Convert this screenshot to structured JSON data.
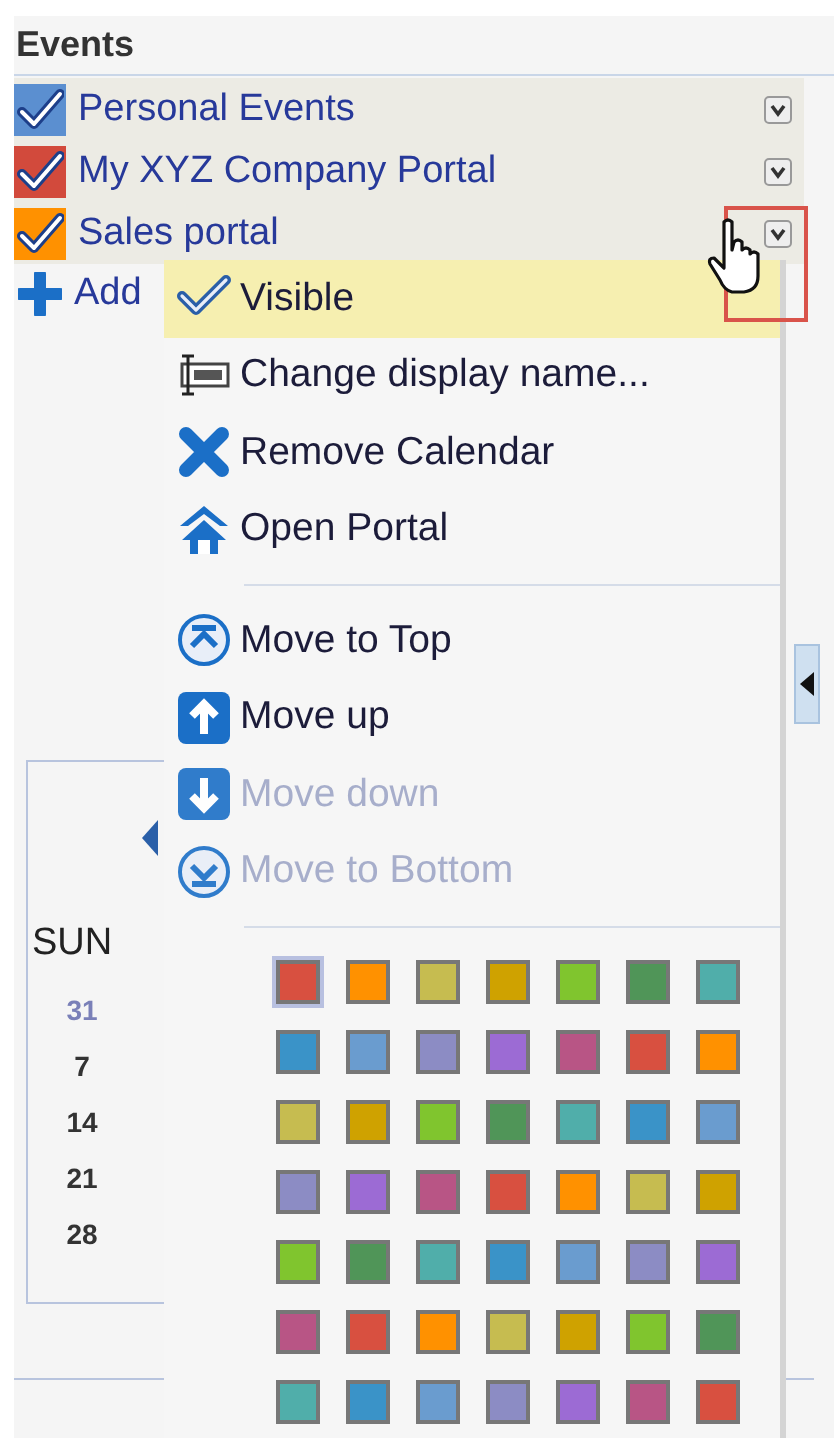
{
  "panel": {
    "title": "Events"
  },
  "calendars": [
    {
      "name": "Personal Events",
      "color": "#5b8fd0",
      "checked": true
    },
    {
      "name": "My XYZ Company Portal",
      "color": "#d24a3c",
      "checked": true
    },
    {
      "name": "Sales portal",
      "color": "#ff9100",
      "checked": true
    }
  ],
  "add_link": {
    "label": "Add"
  },
  "mini_calendar": {
    "weekday": "SUN",
    "days": [
      {
        "label": "31",
        "other_month": true
      },
      {
        "label": "7",
        "other_month": false
      },
      {
        "label": "14",
        "other_month": false
      },
      {
        "label": "21",
        "other_month": false
      },
      {
        "label": "28",
        "other_month": false
      }
    ]
  },
  "context_menu": {
    "groups": [
      [
        {
          "kind": "check",
          "label": "Visible",
          "checked": true,
          "selected": true,
          "disabled": false
        },
        {
          "kind": "rename",
          "label": "Change display name...",
          "selected": false,
          "disabled": false
        },
        {
          "kind": "remove",
          "label": "Remove Calendar",
          "selected": false,
          "disabled": false
        },
        {
          "kind": "portal",
          "label": "Open Portal",
          "selected": false,
          "disabled": false
        }
      ],
      [
        {
          "kind": "top",
          "label": "Move to Top",
          "selected": false,
          "disabled": false
        },
        {
          "kind": "up",
          "label": "Move up",
          "selected": false,
          "disabled": false
        },
        {
          "kind": "down",
          "label": "Move down",
          "selected": false,
          "disabled": true
        },
        {
          "kind": "bottom",
          "label": "Move to Bottom",
          "selected": false,
          "disabled": true
        }
      ]
    ],
    "palette": [
      {
        "color": "#d85040",
        "selected": true
      },
      {
        "color": "#ff9100",
        "selected": false
      },
      {
        "color": "#c6bc50",
        "selected": false
      },
      {
        "color": "#cfa200",
        "selected": false
      },
      {
        "color": "#80c52e",
        "selected": false
      },
      {
        "color": "#509558",
        "selected": false
      },
      {
        "color": "#50aeaa",
        "selected": false
      },
      {
        "color": "#3a93c8",
        "selected": false
      },
      {
        "color": "#6a9ccf",
        "selected": false
      },
      {
        "color": "#8c8cc4",
        "selected": false
      },
      {
        "color": "#9c6bd4",
        "selected": false
      },
      {
        "color": "#b85585",
        "selected": false
      },
      {
        "color": "#d85040",
        "selected": false
      },
      {
        "color": "#ff9100",
        "selected": false
      },
      {
        "color": "#c6bc50",
        "selected": false
      },
      {
        "color": "#cfa200",
        "selected": false
      },
      {
        "color": "#80c52e",
        "selected": false
      },
      {
        "color": "#509558",
        "selected": false
      },
      {
        "color": "#50aeaa",
        "selected": false
      },
      {
        "color": "#3a93c8",
        "selected": false
      },
      {
        "color": "#6a9ccf",
        "selected": false
      },
      {
        "color": "#8c8cc4",
        "selected": false
      },
      {
        "color": "#9c6bd4",
        "selected": false
      },
      {
        "color": "#b85585",
        "selected": false
      },
      {
        "color": "#d85040",
        "selected": false
      },
      {
        "color": "#ff9100",
        "selected": false
      },
      {
        "color": "#c6bc50",
        "selected": false
      },
      {
        "color": "#cfa200",
        "selected": false
      },
      {
        "color": "#80c52e",
        "selected": false
      },
      {
        "color": "#509558",
        "selected": false
      },
      {
        "color": "#50aeaa",
        "selected": false
      },
      {
        "color": "#3a93c8",
        "selected": false
      },
      {
        "color": "#6a9ccf",
        "selected": false
      },
      {
        "color": "#8c8cc4",
        "selected": false
      },
      {
        "color": "#9c6bd4",
        "selected": false
      },
      {
        "color": "#b85585",
        "selected": false
      },
      {
        "color": "#d85040",
        "selected": false
      },
      {
        "color": "#ff9100",
        "selected": false
      },
      {
        "color": "#c6bc50",
        "selected": false
      },
      {
        "color": "#cfa200",
        "selected": false
      },
      {
        "color": "#80c52e",
        "selected": false
      },
      {
        "color": "#509558",
        "selected": false
      },
      {
        "color": "#50aeaa",
        "selected": false
      },
      {
        "color": "#3a93c8",
        "selected": false
      },
      {
        "color": "#6a9ccf",
        "selected": false
      },
      {
        "color": "#8c8cc4",
        "selected": false
      },
      {
        "color": "#9c6bd4",
        "selected": false
      },
      {
        "color": "#b85585",
        "selected": false
      },
      {
        "color": "#d85040",
        "selected": false
      }
    ]
  }
}
